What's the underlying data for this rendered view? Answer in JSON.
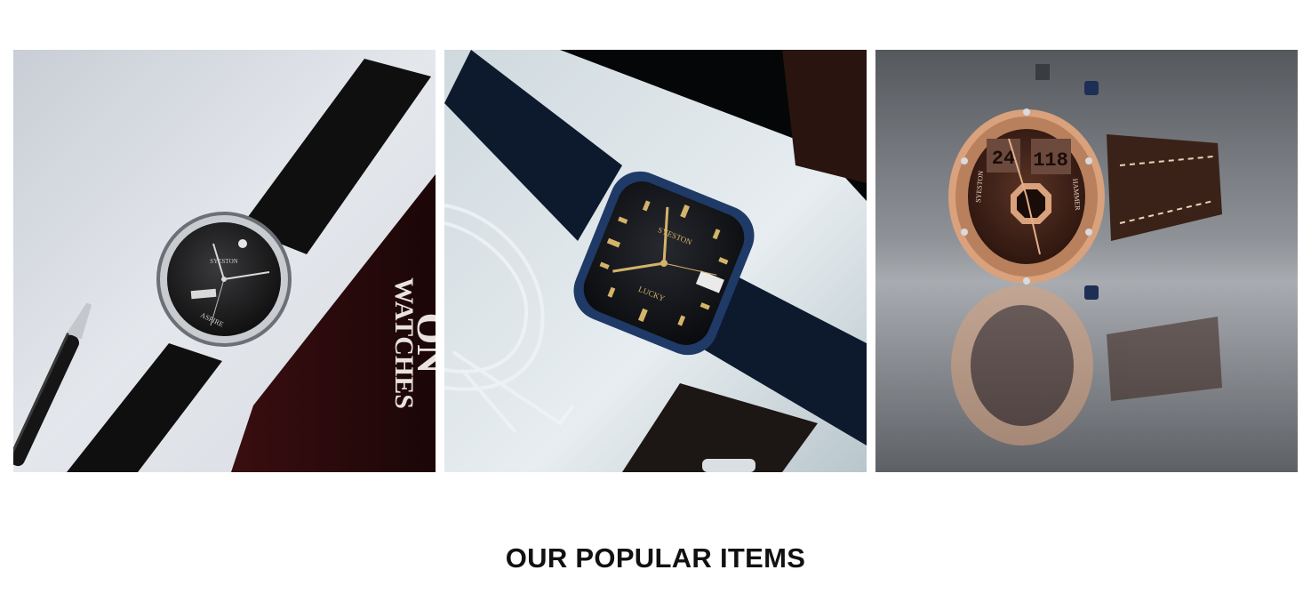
{
  "gallery": {
    "items": [
      {
        "image": "black-leather-watch-with-pen-photo",
        "dial_brand": "SYESTON",
        "dial_model": "ASPIRE",
        "box_text_line1": "WATCHES",
        "box_text_line2": "ON"
      },
      {
        "image": "blue-tonneau-watch-with-glasses-photo",
        "dial_brand": "SYESTON",
        "dial_model": "LUCKY"
      },
      {
        "image": "rose-gold-chronograph-watch-reflection-photo",
        "dial_brand": "SYESTON",
        "dial_model": "HAMMER",
        "digital_left": "24",
        "digital_right": "118"
      }
    ]
  },
  "section": {
    "title": "OUR POPULAR ITEMS"
  },
  "colors": {
    "title_text": "#111111",
    "background": "#ffffff",
    "rose_gold": "#d9a17c",
    "steel_blue": "#1f3a66"
  }
}
